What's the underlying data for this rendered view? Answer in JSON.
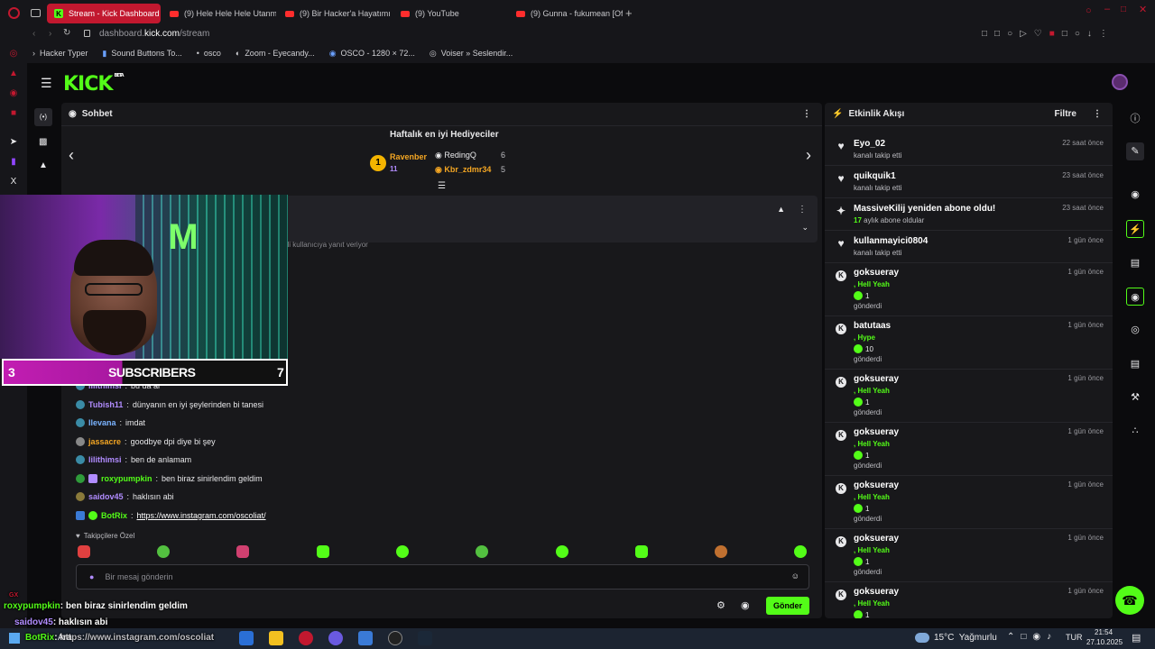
{
  "browser": {
    "tabs": [
      {
        "label": "Stream - Kick Dashboard",
        "active": true
      },
      {
        "label": "(9) Hele Hele Hele Utanm"
      },
      {
        "label": "(9) Bir Hacker'a Hayatımı"
      },
      {
        "label": "(9) YouTube"
      },
      {
        "label": "(9) Gunna - fukumean [Of"
      }
    ],
    "url_domain": "dashboard.",
    "url_host": "kick.com",
    "url_path": "/stream",
    "bookmarks": [
      "Hacker Typer",
      "Sound Buttons To...",
      "osco",
      "Zoom - Eyecandy...",
      "OSCO - 1280 × 72...",
      "Voiser » Seslendir..."
    ]
  },
  "kick": {
    "logo": "KICK",
    "logo_tag": "BETA"
  },
  "chat": {
    "title": "Sohbet",
    "gift_title": "Haftalık en iyi Hediyeciler",
    "top1": {
      "rank": "1",
      "name": "Ravenber",
      "count": "11"
    },
    "top2": {
      "name": "RedingQ",
      "count": "6"
    },
    "top3": {
      "name": "Kbr_zdmr34",
      "count": "5"
    },
    "replying_text": "nli kullanıcıya yanıt veriyor",
    "messages": [
      {
        "user": "lilithimsi",
        "text": "bu da al"
      },
      {
        "user": "Tubish11",
        "text": "dünyanın en iyi şeylerinden bi tanesi"
      },
      {
        "user": "llevana",
        "text": "imdat"
      },
      {
        "user": "jassacre",
        "text": "goodbye dpi diye bi şey"
      },
      {
        "user": "lilithimsi",
        "text": "ben de anlamam"
      },
      {
        "user": "roxypumpkin",
        "text": "ben biraz sinirlendim geldim"
      },
      {
        "user": "saidov45",
        "text": "haklısın abi"
      },
      {
        "user": "BotRix",
        "text": "https://www.instagram.com/oscoliat/"
      }
    ],
    "emote_section": "Takipçilere Özel",
    "input_placeholder": "Bir mesaj gönderin",
    "send_label": "Gönder"
  },
  "overlay": {
    "subs_left": "3",
    "subs_label": "SUBSCRIBERS",
    "subs_right": "7",
    "bottom_user1": "roxypumpkin",
    "bottom_msg1": "ben biraz sinirlendim geldim",
    "bottom_user2": "saidov45",
    "bottom_msg2": ": haklısın abi",
    "bottom_user3": "BotRix",
    "bottom_msg3": "https://www.instagram.com/oscoliat",
    "gx": "GX"
  },
  "activity": {
    "title": "Etkinlik Akışı",
    "filter": "Filtre",
    "events": [
      {
        "name": "Eyo_02",
        "sub": "kanalı takip etti",
        "time": "22 saat önce"
      },
      {
        "name": "quikquik1",
        "sub": "kanalı takip etti",
        "time": "23 saat önce"
      },
      {
        "name": "MassiveKilij yeniden abone oldu!",
        "months": "17",
        "sub": " aylık abone oldular",
        "time": "23 saat önce"
      },
      {
        "name": "kullanmayici0804",
        "sub": "kanalı takip etti",
        "time": "1 gün önce"
      },
      {
        "name": "goksueray",
        "gift": ", Hell Yeah",
        "count": "1",
        "sub": "gönderdi",
        "time": "1 gün önce"
      },
      {
        "name": "batutaas",
        "gift": ", Hype",
        "count": "10",
        "sub": "gönderdi",
        "time": "1 gün önce"
      },
      {
        "name": "goksueray",
        "gift": ", Hell Yeah",
        "count": "1",
        "sub": "gönderdi",
        "time": "1 gün önce"
      },
      {
        "name": "goksueray",
        "gift": ", Hell Yeah",
        "count": "1",
        "sub": "gönderdi",
        "time": "1 gün önce"
      },
      {
        "name": "goksueray",
        "gift": ", Hell Yeah",
        "count": "1",
        "sub": "gönderdi",
        "time": "1 gün önce"
      },
      {
        "name": "goksueray",
        "gift": ", Hell Yeah",
        "count": "1",
        "sub": "gönderdi",
        "time": "1 gün önce"
      },
      {
        "name": "goksueray",
        "gift": ", Hell Yeah",
        "count": "1",
        "sub": "",
        "time": "1 gün önce"
      }
    ]
  },
  "taskbar": {
    "weather": "15°C  Yağmurlu",
    "lang": "TUR",
    "time": "21:54",
    "date": "27.10.2025",
    "search": "Ara"
  },
  "colors": {
    "kick_green": "#53fc18",
    "opera_red": "#c2182f",
    "panel": "#18181b"
  }
}
